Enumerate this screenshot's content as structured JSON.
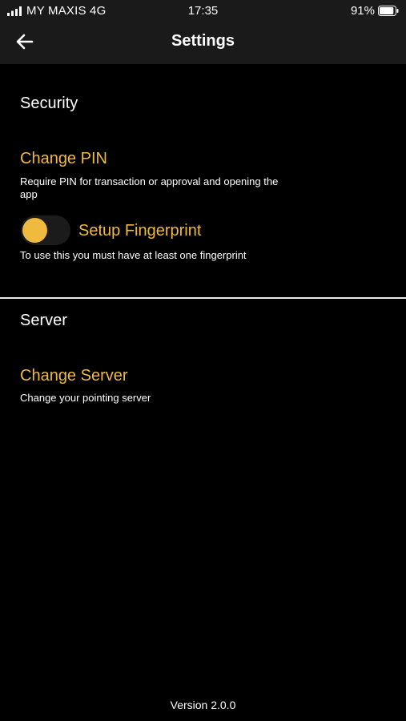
{
  "status_bar": {
    "carrier": "MY MAXIS 4G",
    "time": "17:35",
    "battery": "91%",
    "battery_level": 0.91,
    "signal_icon": "signal-bars-icon",
    "battery_icon": "battery-icon"
  },
  "header": {
    "title": "Settings",
    "back_icon": "arrow-left-icon"
  },
  "security": {
    "section_title": "Security",
    "change_pin": {
      "title": "Change PIN",
      "description": "Require PIN for transaction or approval and opening the app"
    },
    "fingerprint": {
      "title": "Setup Fingerprint",
      "description": "To use this you must have at least one fingerprint",
      "toggle_on": false
    }
  },
  "server": {
    "section_title": "Server",
    "change_server": {
      "title": "Change Server",
      "description": "Change your pointing server"
    }
  },
  "footer": {
    "version": "Version 2.0.0"
  },
  "colors": {
    "background": "#000000",
    "bar_background": "#1a1a1a",
    "accent": "#f0b93f",
    "text": "#ffffff",
    "divider": "#e8e8e8"
  }
}
